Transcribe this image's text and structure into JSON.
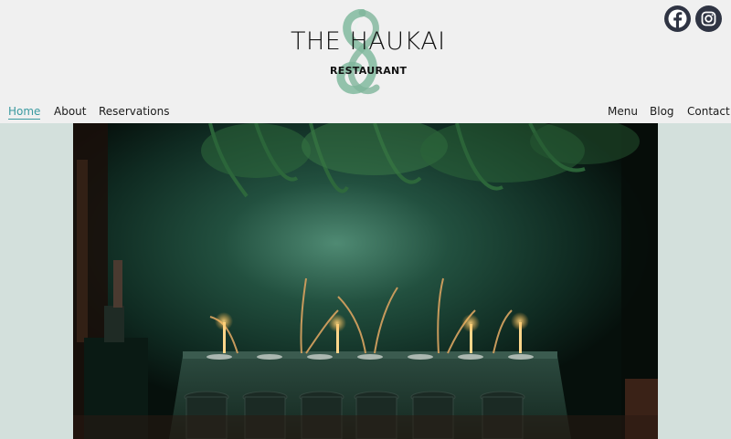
{
  "brand": {
    "title": "THE HAUKAI",
    "subtitle": "RESTAURANT",
    "logo_icon": "twisted-koru-icon",
    "logo_color": "#8cbfa6"
  },
  "social": [
    {
      "name": "Facebook",
      "icon": "facebook-icon"
    },
    {
      "name": "Instagram",
      "icon": "instagram-icon"
    }
  ],
  "nav": {
    "left": [
      {
        "label": "Home",
        "active": true
      },
      {
        "label": "About"
      },
      {
        "label": "Reservations"
      }
    ],
    "right": [
      {
        "label": "Menu"
      },
      {
        "label": "Blog"
      },
      {
        "label": "Contact"
      }
    ],
    "accent_color": "#3a9aa0"
  },
  "hero": {
    "image_icon": "dining-room-photo",
    "band_color": "#d3e0dc"
  }
}
